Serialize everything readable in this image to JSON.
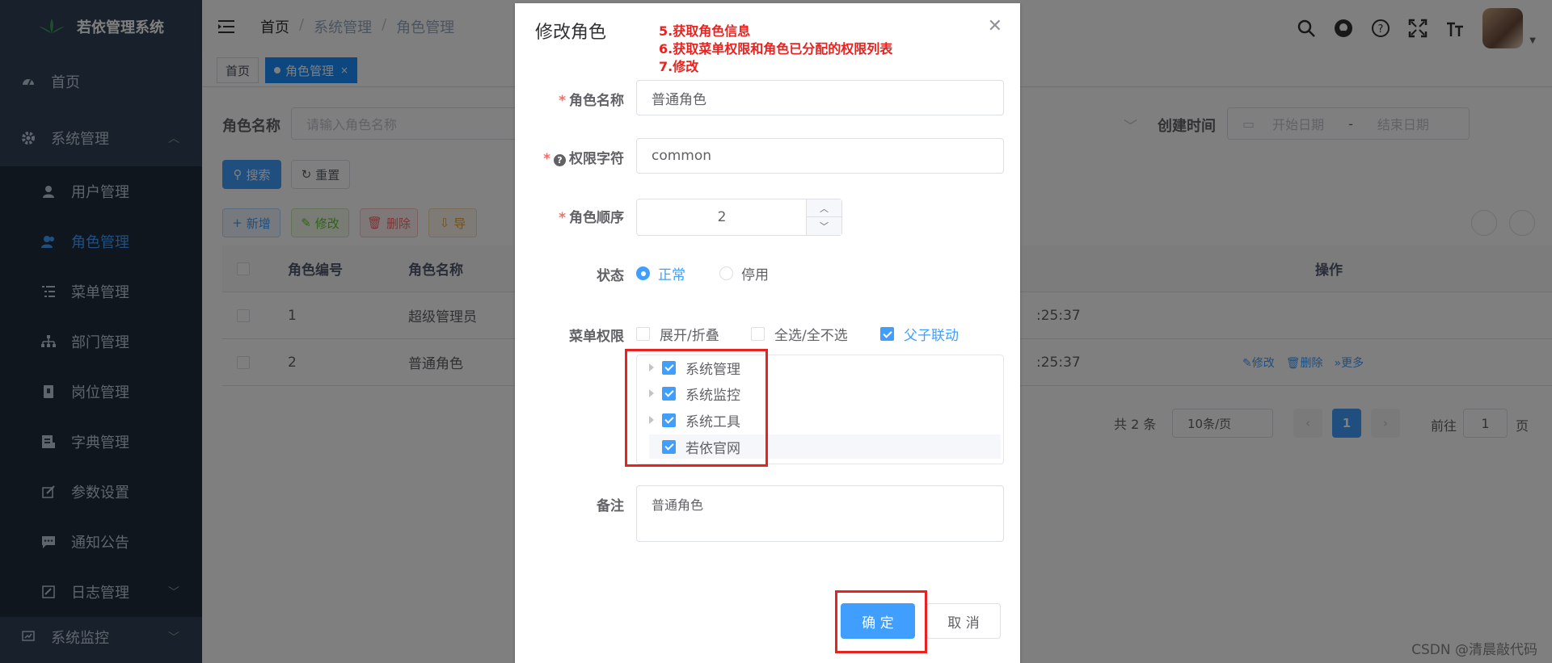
{
  "app": {
    "title": "若依管理系统"
  },
  "sidebar": {
    "items": [
      {
        "label": "首页",
        "icon": "dashboard-icon"
      },
      {
        "label": "系统管理",
        "icon": "gear-icon"
      }
    ],
    "sub_items": [
      {
        "label": "用户管理",
        "icon": "user-icon"
      },
      {
        "label": "角色管理",
        "icon": "peoples-icon"
      },
      {
        "label": "菜单管理",
        "icon": "tree-table-icon"
      },
      {
        "label": "部门管理",
        "icon": "tree-icon"
      },
      {
        "label": "岗位管理",
        "icon": "post-icon"
      },
      {
        "label": "字典管理",
        "icon": "dict-icon"
      },
      {
        "label": "参数设置",
        "icon": "edit-icon"
      },
      {
        "label": "通知公告",
        "icon": "message-icon"
      },
      {
        "label": "日志管理",
        "icon": "log-icon"
      }
    ],
    "last": {
      "label": "系统监控",
      "icon": "monitor-icon"
    }
  },
  "breadcrumb": [
    "首页",
    "系统管理",
    "角色管理"
  ],
  "tags": [
    "首页",
    "角色管理"
  ],
  "filters": {
    "role_name_label": "角色名称",
    "role_name_placeholder": "请输入角色名称",
    "create_time_label": "创建时间",
    "start_date": "开始日期",
    "end_date": "结束日期",
    "date_sep": "-"
  },
  "buttons": {
    "search": "搜索",
    "reset": "重置",
    "add": "新增",
    "edit": "修改",
    "delete": "删除",
    "export": "导"
  },
  "table": {
    "headers": [
      "角色编号",
      "角色名称",
      "操作"
    ],
    "rows": [
      {
        "id": "1",
        "name": "超级管理员",
        "time": ":25:37"
      },
      {
        "id": "2",
        "name": "普通角色",
        "time": ":25:37",
        "ops": [
          "修改",
          "删除",
          "更多"
        ]
      }
    ]
  },
  "pagination": {
    "total": "共 2 条",
    "page_size": "10条/页",
    "current": "1",
    "goto_label": "前往",
    "goto_value": "1",
    "goto_unit": "页"
  },
  "dialog": {
    "title": "修改角色",
    "annotations": [
      "5.获取角色信息",
      "6.获取菜单权限和角色已分配的权限列表",
      "7.修改"
    ],
    "fields": {
      "role_name_label": "角色名称",
      "role_name_value": "普通角色",
      "role_key_label": "权限字符",
      "role_key_value": "common",
      "role_sort_label": "角色顺序",
      "role_sort_value": "2",
      "status_label": "状态",
      "status_options": [
        "正常",
        "停用"
      ],
      "menu_label": "菜单权限",
      "menu_options": [
        "展开/折叠",
        "全选/全不选",
        "父子联动"
      ],
      "remark_label": "备注",
      "remark_value": "普通角色"
    },
    "tree": [
      "系统管理",
      "系统监控",
      "系统工具",
      "若依官网"
    ],
    "confirm": "确 定",
    "cancel": "取 消"
  },
  "watermark": "CSDN @清晨敲代码",
  "colors": {
    "primary": "#409eff",
    "sidebar": "#304156",
    "annotation": "#e8221f"
  }
}
